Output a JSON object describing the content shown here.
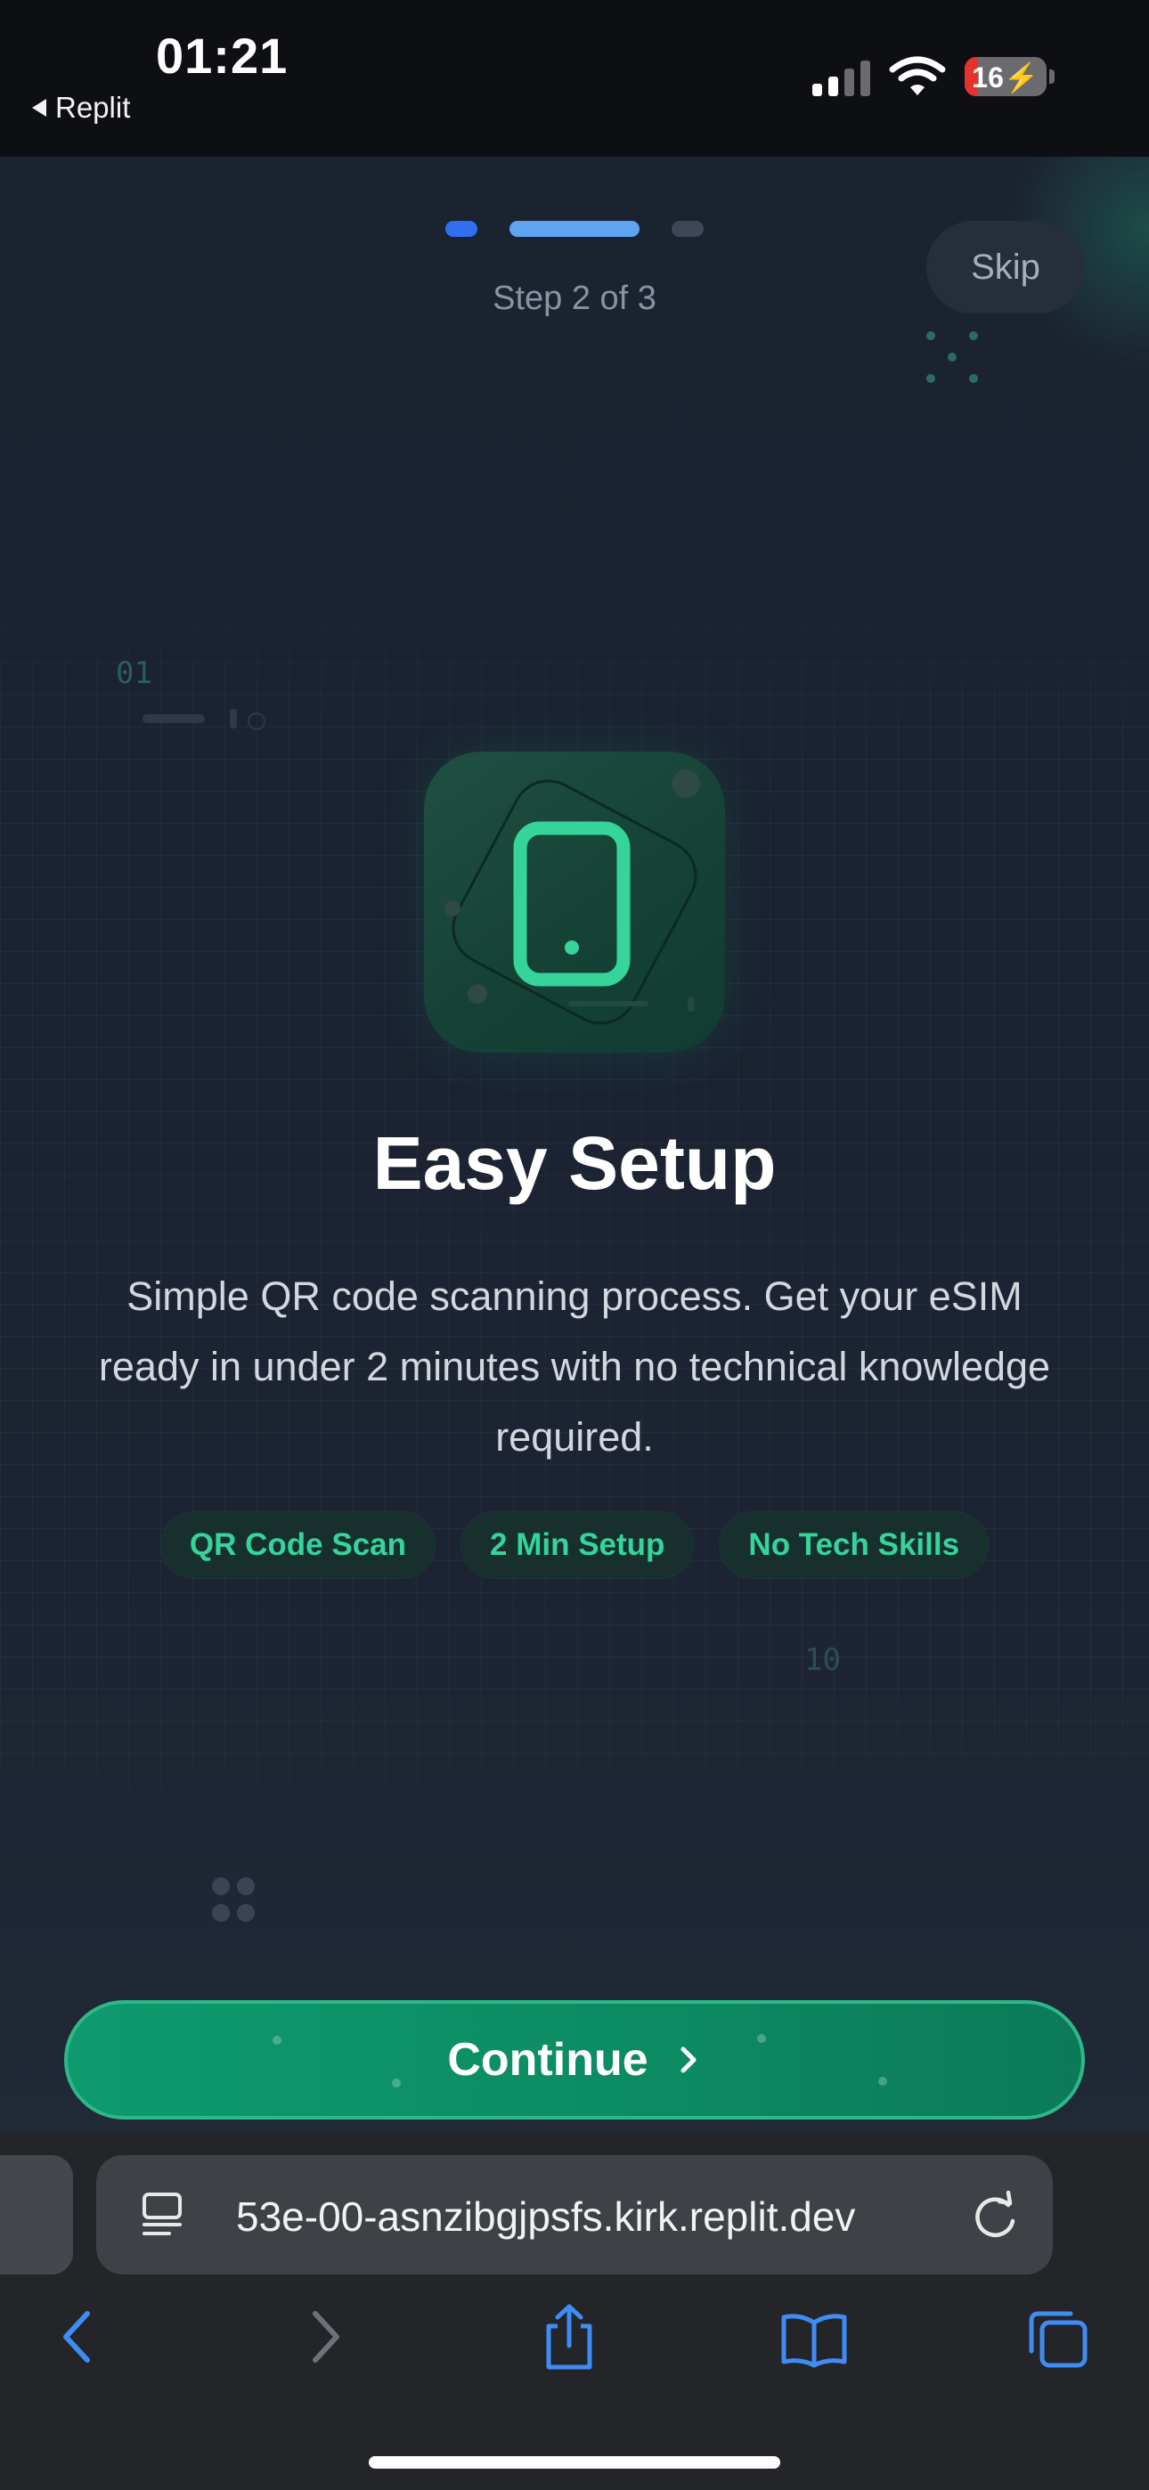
{
  "status_bar": {
    "time": "01:21",
    "back_app": "Replit",
    "battery": "16"
  },
  "onboarding": {
    "step_label": "Step 2 of 3",
    "skip_label": "Skip",
    "progress": {
      "current": 2,
      "total": 3
    },
    "deco_text_top": "01",
    "deco_text_bottom": "10",
    "title": "Easy Setup",
    "description": "Simple QR code scanning process. Get your eSIM ready in under 2 minutes with no technical knowledge required.",
    "chips": [
      "QR Code Scan",
      "2 Min Setup",
      "No Tech Skills"
    ],
    "continue_label": "Continue",
    "icon": "smartphone-icon",
    "colors": {
      "accent": "#10b981",
      "progress_active": "#5fa3f3",
      "progress_done": "#2f6ff0",
      "background": "#1b2331"
    }
  },
  "browser": {
    "url": "53e-00-asnzibgjpsfs.kirk.replit.dev",
    "icons": [
      "reader-icon",
      "reload-icon",
      "back-icon",
      "forward-icon",
      "share-icon",
      "bookmarks-icon",
      "tabs-icon"
    ]
  }
}
